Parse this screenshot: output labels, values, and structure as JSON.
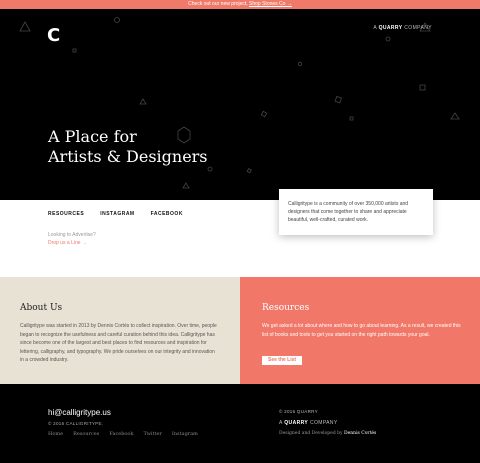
{
  "banner": {
    "text": "Check out our new project,",
    "link": "Shop Stones Co →"
  },
  "header": {
    "logo": "C",
    "quarry_prefix": "A",
    "quarry_brand": "QUARRY",
    "quarry_suffix": "COMPANY"
  },
  "hero": {
    "line1": "A Place for",
    "line2": "Artists & Designers"
  },
  "nav": {
    "items": [
      "RESOURCES",
      "INSTAGRAM",
      "FACEBOOK"
    ]
  },
  "advertise": {
    "question": "Looking to Advertise?",
    "link": "Drop us a Line →"
  },
  "card": {
    "text": "Calligritype is a community of over 350,000 artists and designers that come together to share and appreciate beautiful, well-crafted, curated work."
  },
  "about": {
    "title": "About Us",
    "body": "Calligritype was started in 2013 by Dennis Cortés to collect inspiration. Over time, people began to recognize the usefulness and careful curation behind this idea. Calligritype has since become one of the largest and best places to find resources and inspiration for lettering, calligraphy, and typography. We pride ourselves on our integrity and innovation in a crowded industry."
  },
  "resources": {
    "title": "Resources",
    "body": "We get asked a lot about where and how to go about learning. As a result, we created this list of books and tools to get you started on the right path towards your goal.",
    "button": "See the List"
  },
  "footer": {
    "email": "hi@calligritype.us",
    "copyright": "© 2016 CALLIGRITYPE.",
    "links": [
      "Home",
      "Resources",
      "Facebook",
      "Twitter",
      "Instagram"
    ],
    "right_copyright": "© 2016 QUARRY",
    "quarry_prefix": "A",
    "quarry_brand": "QUARRY",
    "quarry_suffix": "COMPANY",
    "credit_prefix": "Designed and Developed by",
    "credit_name": "Dennis Cortés"
  },
  "colors": {
    "accent": "#f17868",
    "about_bg": "#e8e2d5",
    "dark": "#000000"
  }
}
